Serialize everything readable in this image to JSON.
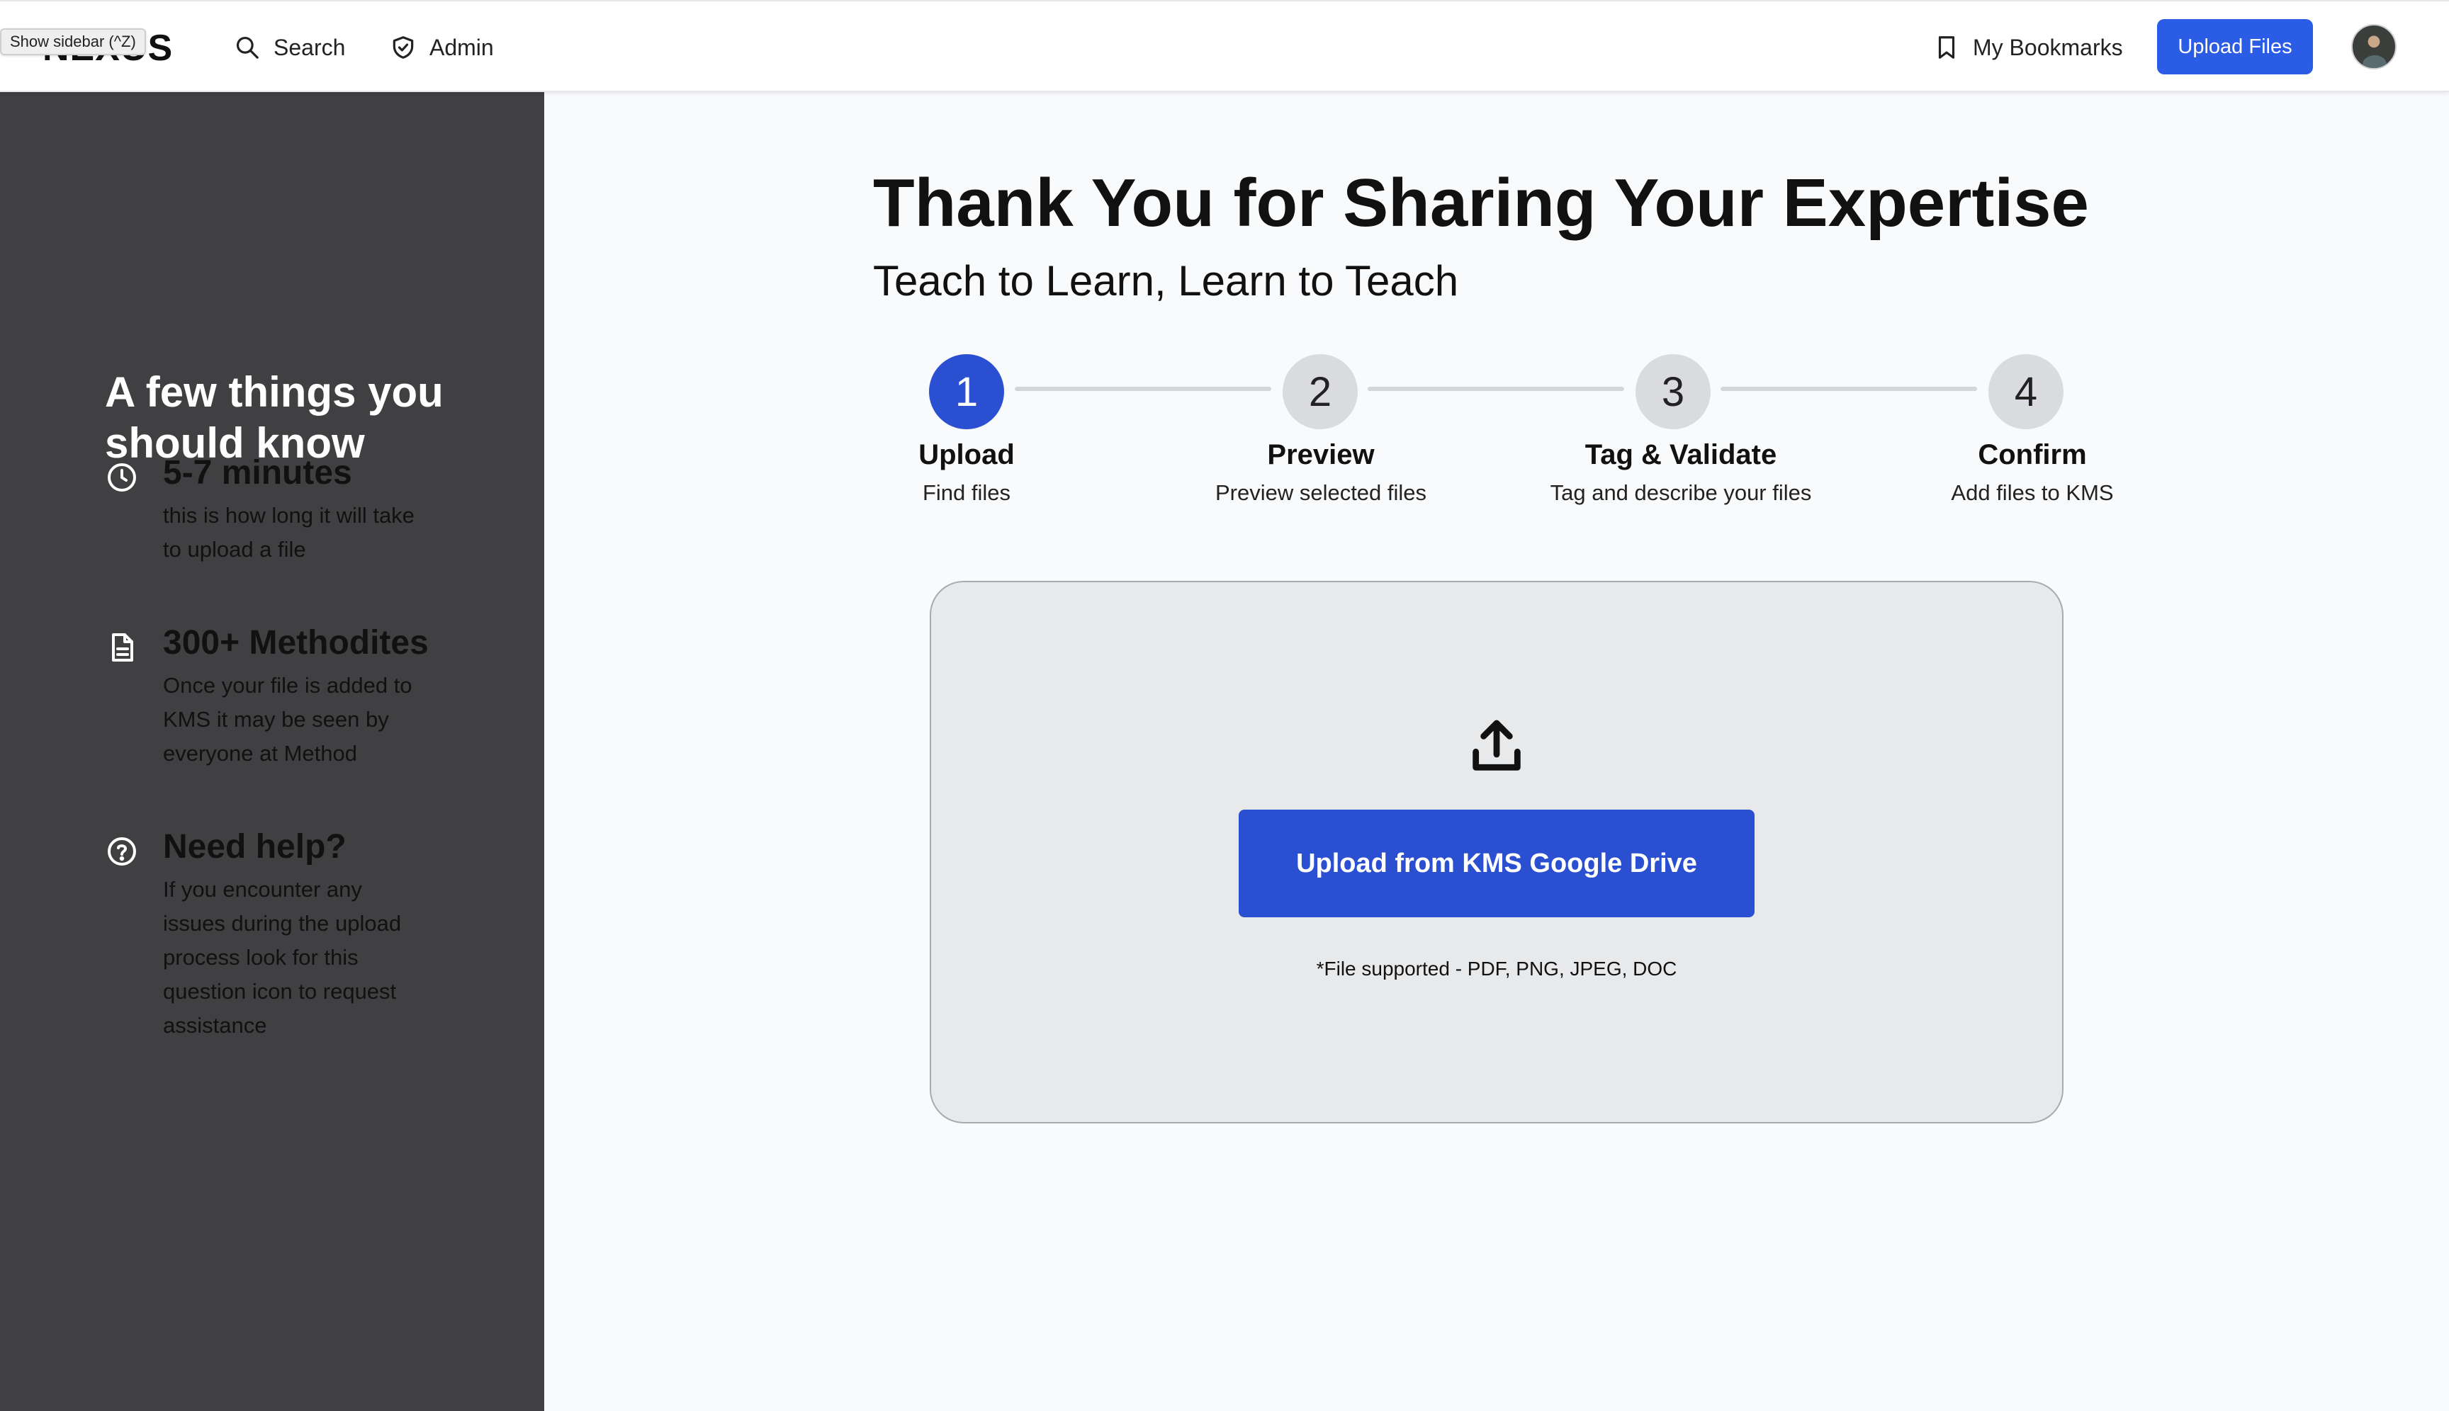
{
  "nav": {
    "logo": "NEXUS",
    "tooltip": "Show sidebar (^Z)",
    "search_label": "Search",
    "admin_label": "Admin",
    "bookmarks_label": "My Bookmarks",
    "upload_button": "Upload Files"
  },
  "sidebar": {
    "title": "A few things you should know",
    "items": [
      {
        "icon": "clock-icon",
        "heading": "5-7 minutes",
        "body": "this is how long it will take to upload a file"
      },
      {
        "icon": "document-icon",
        "heading": "300+ Methodites",
        "body": "Once your file is added to KMS it may be seen by everyone at Method"
      },
      {
        "icon": "question-circle-icon",
        "heading": "Need help?",
        "body": "If you encounter any issues during the upload process look for this question icon to request assistance"
      }
    ]
  },
  "main": {
    "title": "Thank You for Sharing Your Expertise",
    "subtitle": "Teach to Learn, Learn to Teach",
    "active_step": 1,
    "steps": [
      {
        "number": "1",
        "label": "Upload",
        "desc": "Find files"
      },
      {
        "number": "2",
        "label": "Preview",
        "desc": "Preview selected files"
      },
      {
        "number": "3",
        "label": "Tag & Validate",
        "desc": "Tag and describe your files"
      },
      {
        "number": "4",
        "label": "Confirm",
        "desc": "Add files to KMS"
      }
    ],
    "dropzone": {
      "button_label": "Upload from KMS Google Drive",
      "note": "*File supported - PDF, PNG, JPEG, DOC"
    }
  },
  "colors": {
    "accent": "#2b4fd1",
    "sidebar_bg": "#404043",
    "page_bg": "#f9fafb"
  }
}
